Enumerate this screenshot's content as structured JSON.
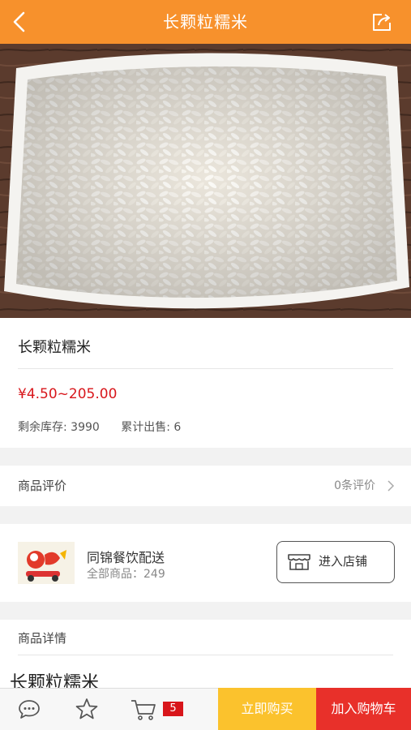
{
  "header": {
    "title": "长颗粒糯米",
    "back_icon": "chevron-left-icon",
    "share_icon": "share-icon",
    "accent": "#f7912c"
  },
  "product": {
    "image_subject": "glutinous rice on a white plate",
    "name": "长颗粒糯米",
    "price": "¥4.50~205.00",
    "stock": "剩余库存: 3990",
    "sold": "累计出售: 6",
    "price_color": "#d8161b"
  },
  "reviews": {
    "label": "商品评价",
    "count": "0条评价"
  },
  "shop": {
    "name": "同锦餐饮配送",
    "goods_label": "全部商品：",
    "goods_count": "249",
    "enter_label": "进入店铺"
  },
  "detail": {
    "label": "商品详情",
    "body": "长颗粒糯米"
  },
  "bottom": {
    "cart_count": "5",
    "buy_now": "立即购买",
    "add_to_cart": "加入购物车",
    "buy_color": "#fbc22d",
    "cart_btn_color": "#e8302a"
  }
}
